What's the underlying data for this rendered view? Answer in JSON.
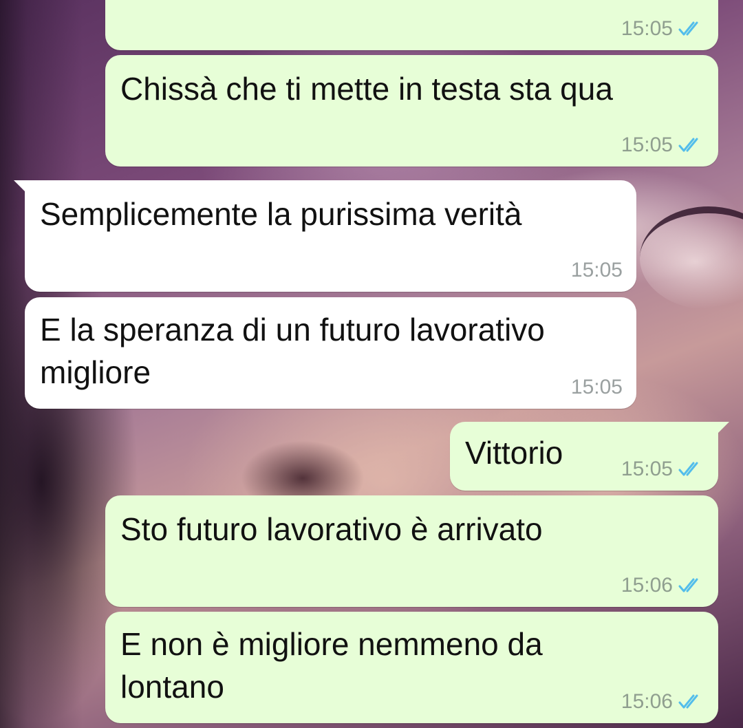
{
  "colors": {
    "outgoing_bubble": "#e7fed7",
    "incoming_bubble": "#ffffff",
    "read_ticks": "#53bdeb",
    "timestamp": "#8f9e8f"
  },
  "icons": {
    "read_status": "double-check-icon"
  },
  "messages": [
    {
      "direction": "outgoing",
      "text": "",
      "time": "15:05",
      "status": "read"
    },
    {
      "direction": "outgoing",
      "text": "Chissà che ti mette in testa sta qua",
      "time": "15:05",
      "status": "read"
    },
    {
      "direction": "incoming",
      "text": "Semplicemente la purissima verità",
      "time": "15:05"
    },
    {
      "direction": "incoming",
      "text": "E la speranza di un futuro lavorativo\nmigliore",
      "time": "15:05"
    },
    {
      "direction": "outgoing",
      "text": "Vittorio",
      "time": "15:05",
      "status": "read"
    },
    {
      "direction": "outgoing",
      "text": "Sto futuro lavorativo è arrivato",
      "time": "15:06",
      "status": "read"
    },
    {
      "direction": "outgoing",
      "text": "E non è migliore nemmeno da\nlontano",
      "time": "15:06",
      "status": "read"
    }
  ]
}
